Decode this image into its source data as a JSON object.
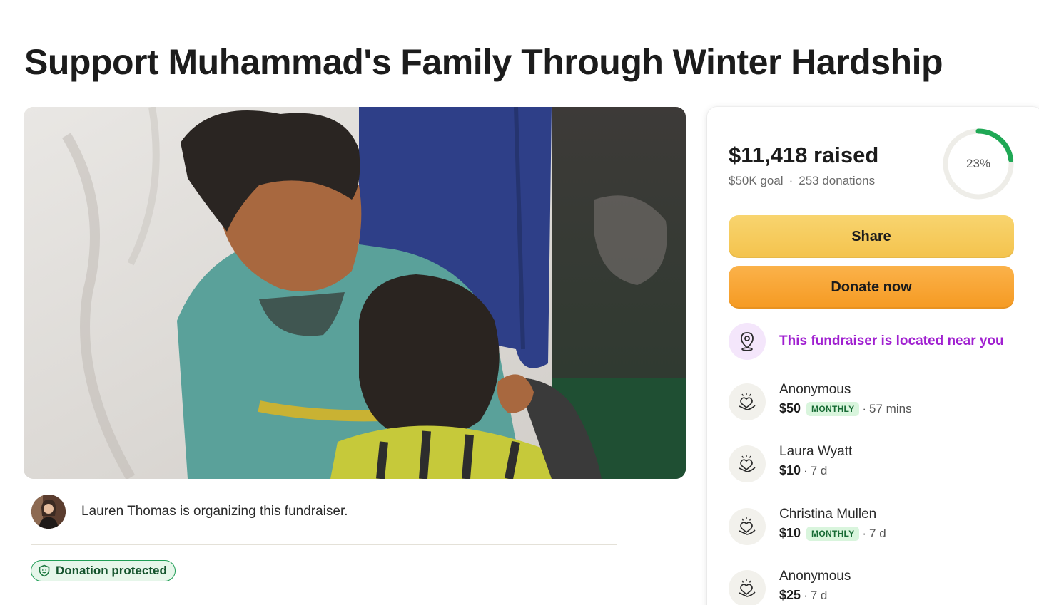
{
  "page": {
    "title": "Support Muhammad's Family Through Winter Hardship"
  },
  "organizer": {
    "text": "Lauren Thomas is organizing this fundraiser."
  },
  "badge": {
    "label": "Donation protected"
  },
  "card": {
    "raised": "$11,418 raised",
    "goal": "$50K goal",
    "separator": "·",
    "donations_count": "253 donations",
    "progress_label": "23%",
    "progress_fraction": 0.23,
    "share_label": "Share",
    "donate_label": "Donate now",
    "location_text": "This fundraiser is located near you"
  },
  "donations": [
    {
      "name": "Anonymous",
      "amount": "$50",
      "badge": "MONTHLY",
      "time": "57 mins"
    },
    {
      "name": "Laura Wyatt",
      "amount": "$10",
      "badge": "",
      "time": "7 d"
    },
    {
      "name": "Christina Mullen",
      "amount": "$10",
      "badge": "MONTHLY",
      "time": "7 d"
    },
    {
      "name": "Anonymous",
      "amount": "$25",
      "badge": "",
      "time": "7 d"
    }
  ],
  "colors": {
    "share_button": "#f4c34d",
    "donate_button": "#f59a22",
    "progress": "#1fa855",
    "location_accent": "#a020d0",
    "protected_green": "#1f9d55"
  }
}
